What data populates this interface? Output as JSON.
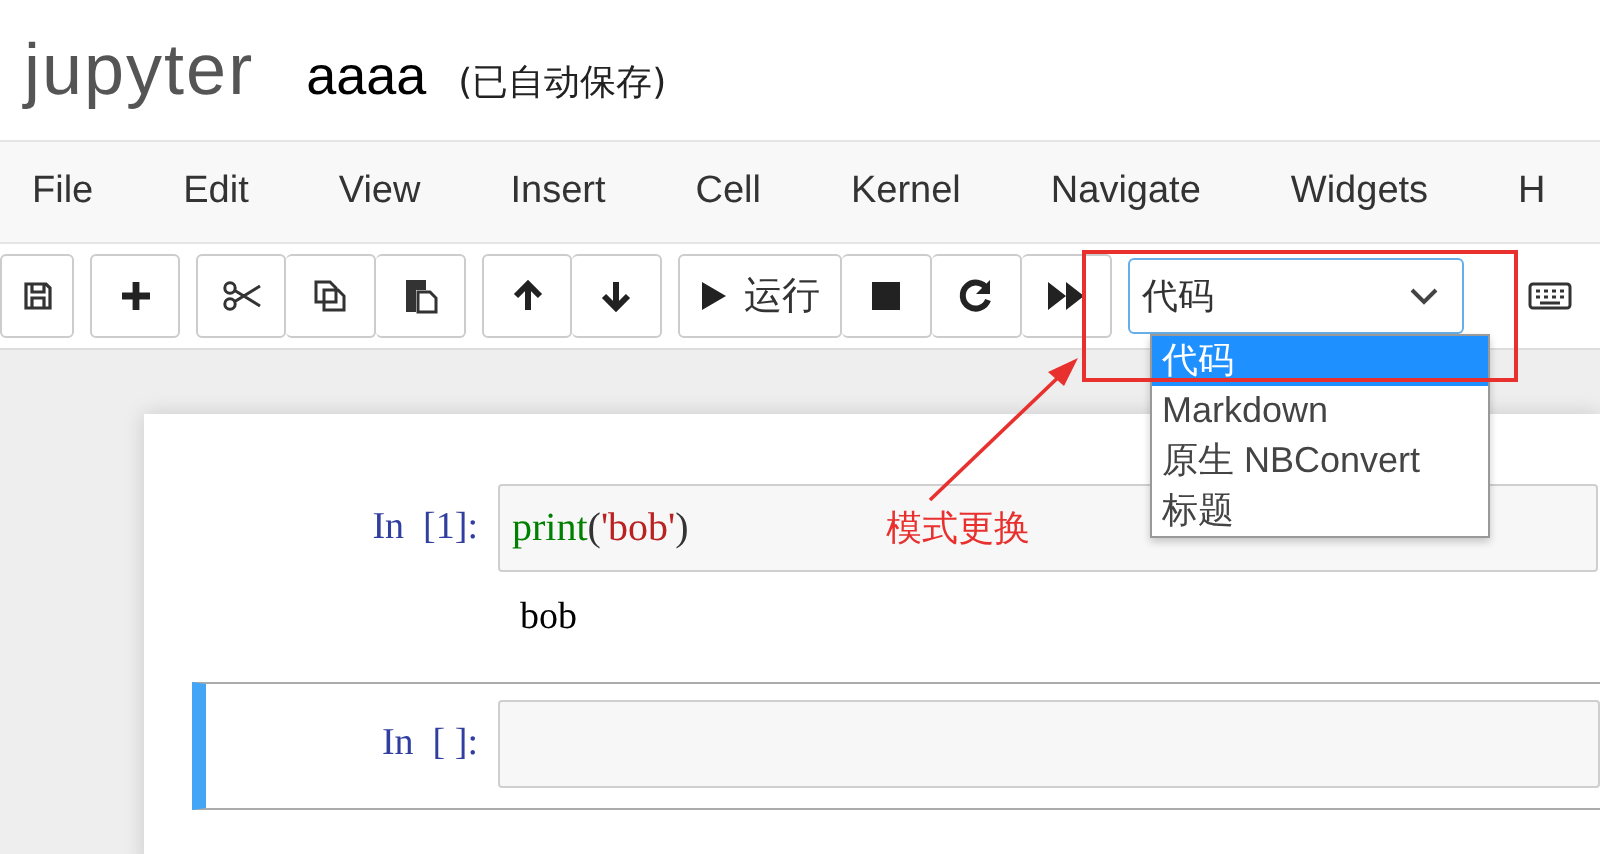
{
  "header": {
    "logo": "jupyter",
    "notebook_name": "aaaa",
    "save_status": "(已自动保存)"
  },
  "menu": [
    "File",
    "Edit",
    "View",
    "Insert",
    "Cell",
    "Kernel",
    "Navigate",
    "Widgets",
    "H"
  ],
  "toolbar": {
    "groups": [
      {
        "buttons": [
          {
            "kind": "save"
          }
        ]
      },
      {
        "buttons": [
          {
            "kind": "add"
          }
        ]
      },
      {
        "buttons": [
          {
            "kind": "cut"
          },
          {
            "kind": "copy"
          },
          {
            "kind": "paste"
          }
        ]
      },
      {
        "buttons": [
          {
            "kind": "up"
          },
          {
            "kind": "down"
          }
        ]
      },
      {
        "buttons": [
          {
            "kind": "run",
            "label": "运行"
          },
          {
            "kind": "stop"
          },
          {
            "kind": "restart"
          },
          {
            "kind": "fastforward"
          }
        ]
      }
    ],
    "cell_type_select": {
      "value": "代码",
      "options": [
        {
          "label": "代码",
          "selected": true
        },
        {
          "label": "Markdown",
          "selected": false
        },
        {
          "label": "原生 NBConvert",
          "selected": false
        },
        {
          "label": "标题",
          "selected": false
        }
      ]
    }
  },
  "cells": [
    {
      "prompt": "In  [1]:",
      "selected": false,
      "code": [
        {
          "text": "print",
          "kind": "builtin"
        },
        {
          "text": "(",
          "kind": "paren"
        },
        {
          "text": "'bob'",
          "kind": "string"
        },
        {
          "text": ")",
          "kind": "paren"
        }
      ],
      "output": "bob"
    },
    {
      "prompt": "In  [ ]:",
      "selected": true
    }
  ],
  "annotation": {
    "label": "模式更换"
  }
}
